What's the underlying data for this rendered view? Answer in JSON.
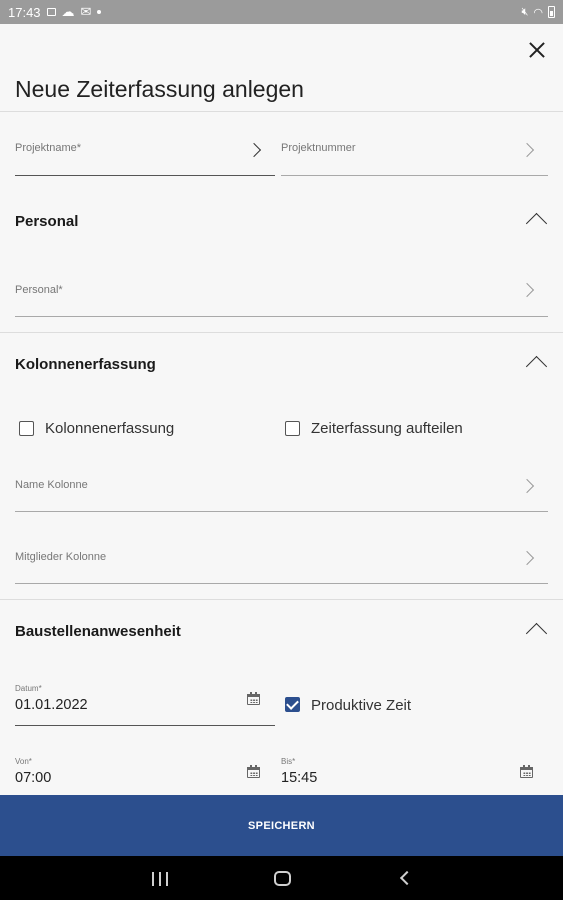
{
  "status_bar": {
    "time": "17:43",
    "icons_left": [
      "image-icon",
      "cloud-icon",
      "mail-icon",
      "dot-icon"
    ],
    "icons_right": [
      "mute-icon",
      "wifi-icon",
      "battery-icon"
    ]
  },
  "dialog": {
    "title": "Neue Zeiterfassung anlegen"
  },
  "project": {
    "name_label": "Projektname*",
    "number_label": "Projektnummer"
  },
  "personal": {
    "section_title": "Personal",
    "field_label": "Personal*"
  },
  "kolonne": {
    "section_title": "Kolonnenerfassung",
    "checkbox_kolonne": {
      "label": "Kolonnenerfassung",
      "checked": false
    },
    "checkbox_aufteilen": {
      "label": "Zeiterfassung aufteilen",
      "checked": false
    },
    "name_label": "Name Kolonne",
    "mitglieder_label": "Mitglieder Kolonne"
  },
  "baustelle": {
    "section_title": "Baustellenanwesenheit",
    "datum_label": "Datum*",
    "datum_value": "01.01.2022",
    "produktiv": {
      "label": "Produktive Zeit",
      "checked": true
    },
    "von_label": "Von*",
    "von_value": "07:00",
    "bis_label": "Bis*",
    "bis_value": "15:45"
  },
  "actions": {
    "save_label": "SPEICHERN"
  },
  "colors": {
    "primary": "#2c4f8e",
    "background": "#f7f7f7",
    "status_bar": "#9b9b9b"
  }
}
